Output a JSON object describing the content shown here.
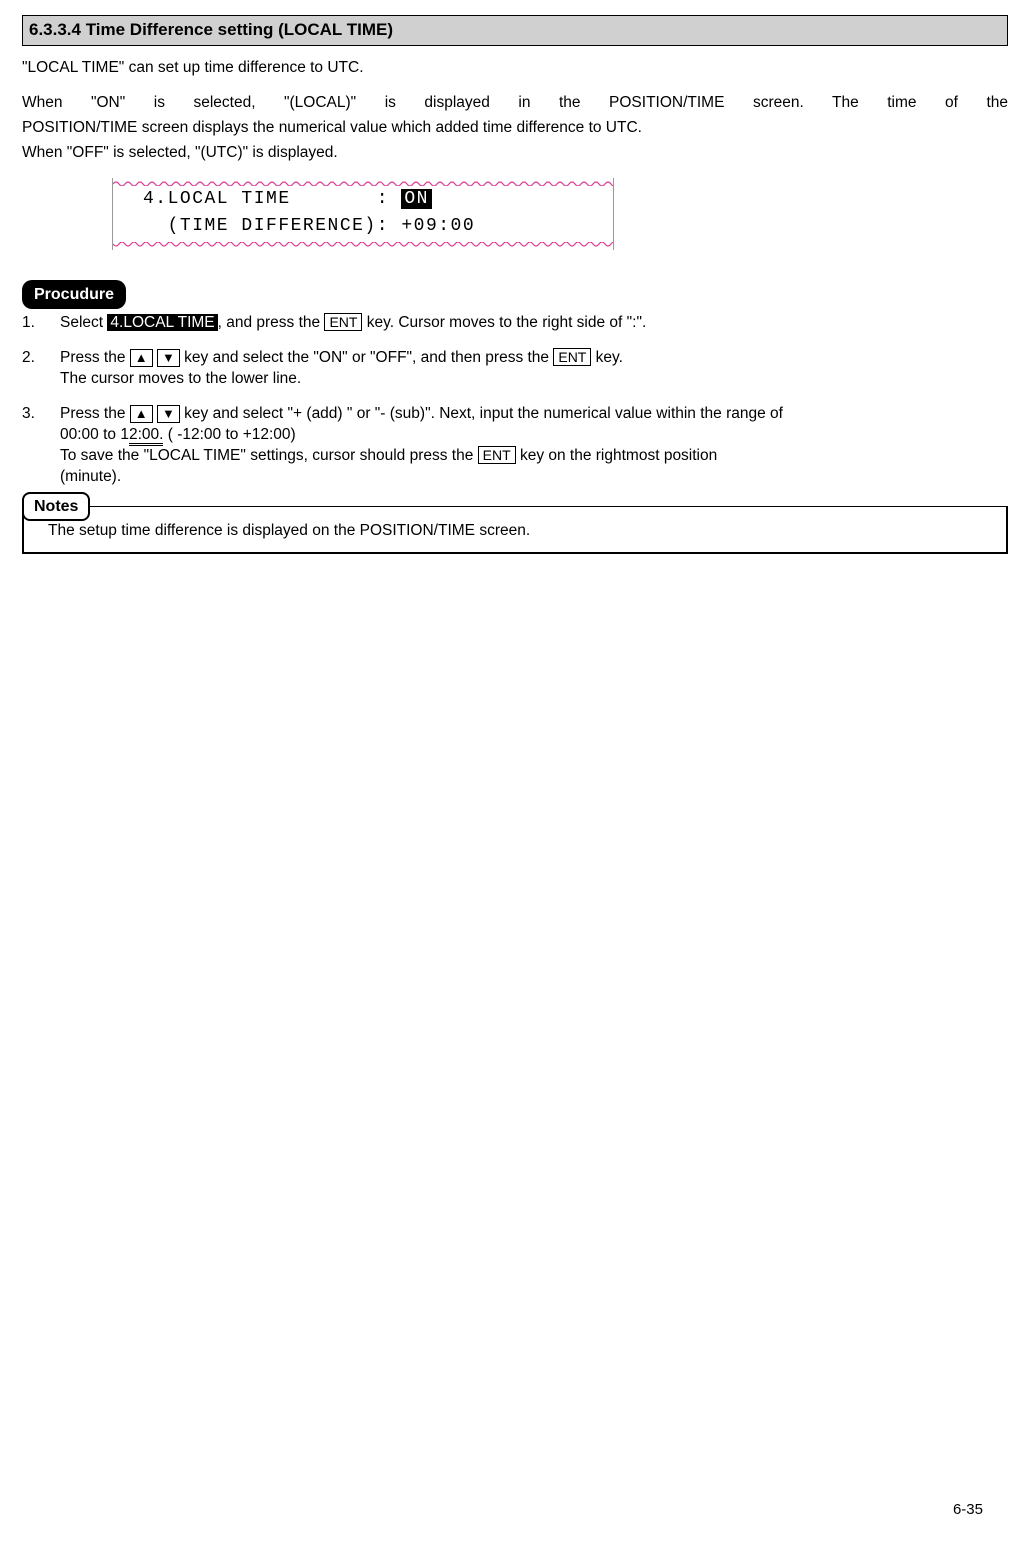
{
  "header": {
    "title": "6.3.3.4 Time Difference setting (LOCAL TIME)"
  },
  "intro": {
    "line1": "\"LOCAL TIME\" can set up time difference to UTC.",
    "line2a": "When \"ON\" is selected, \"(LOCAL)\" is displayed in the POSITION/TIME screen. The time of the",
    "line2b": "POSITION/TIME screen displays the numerical value which added time difference to UTC.",
    "line3": "When \"OFF\" is selected, \"(UTC)\" is displayed."
  },
  "lcd": {
    "line1_pre": "4.LOCAL TIME       : ",
    "line1_on": "ON",
    "line2": "  (TIME DIFFERENCE): +09:00"
  },
  "procedure": {
    "label": "Procudure",
    "steps": {
      "s1": {
        "num": "1.",
        "pre": "Select ",
        "hl": "4.LOCAL TIME",
        "mid": ", and press the ",
        "key1": "ENT",
        "post": " key. Cursor moves to the right side of \":\"."
      },
      "s2": {
        "num": "2.",
        "pre": "Press the ",
        "up": "▲",
        "down": "▼",
        "mid": " key and select the \"ON\" or \"OFF\", and then press the ",
        "key1": "ENT",
        "post": " key.",
        "line2": "The cursor moves to the lower line."
      },
      "s3": {
        "num": "3.",
        "pre": "Press the ",
        "up": "▲",
        "down": "▼",
        "mid": " key and select \"+ (add) \" or \"- (sub)\". Next, input the numerical value within the range of",
        "line2a": "00:00 to 1",
        "dbl": "2:00.",
        "line2b": " ( -12:00 to +12:00)",
        "line3a": "To save the \"LOCAL TIME\" settings, cursor should press the ",
        "key1": "ENT",
        "line3b": " key on the rightmost position",
        "line4": "(minute)."
      }
    }
  },
  "notes": {
    "label": "Notes",
    "text": "The setup time difference is displayed on the POSITION/TIME screen."
  },
  "page": "6-35"
}
